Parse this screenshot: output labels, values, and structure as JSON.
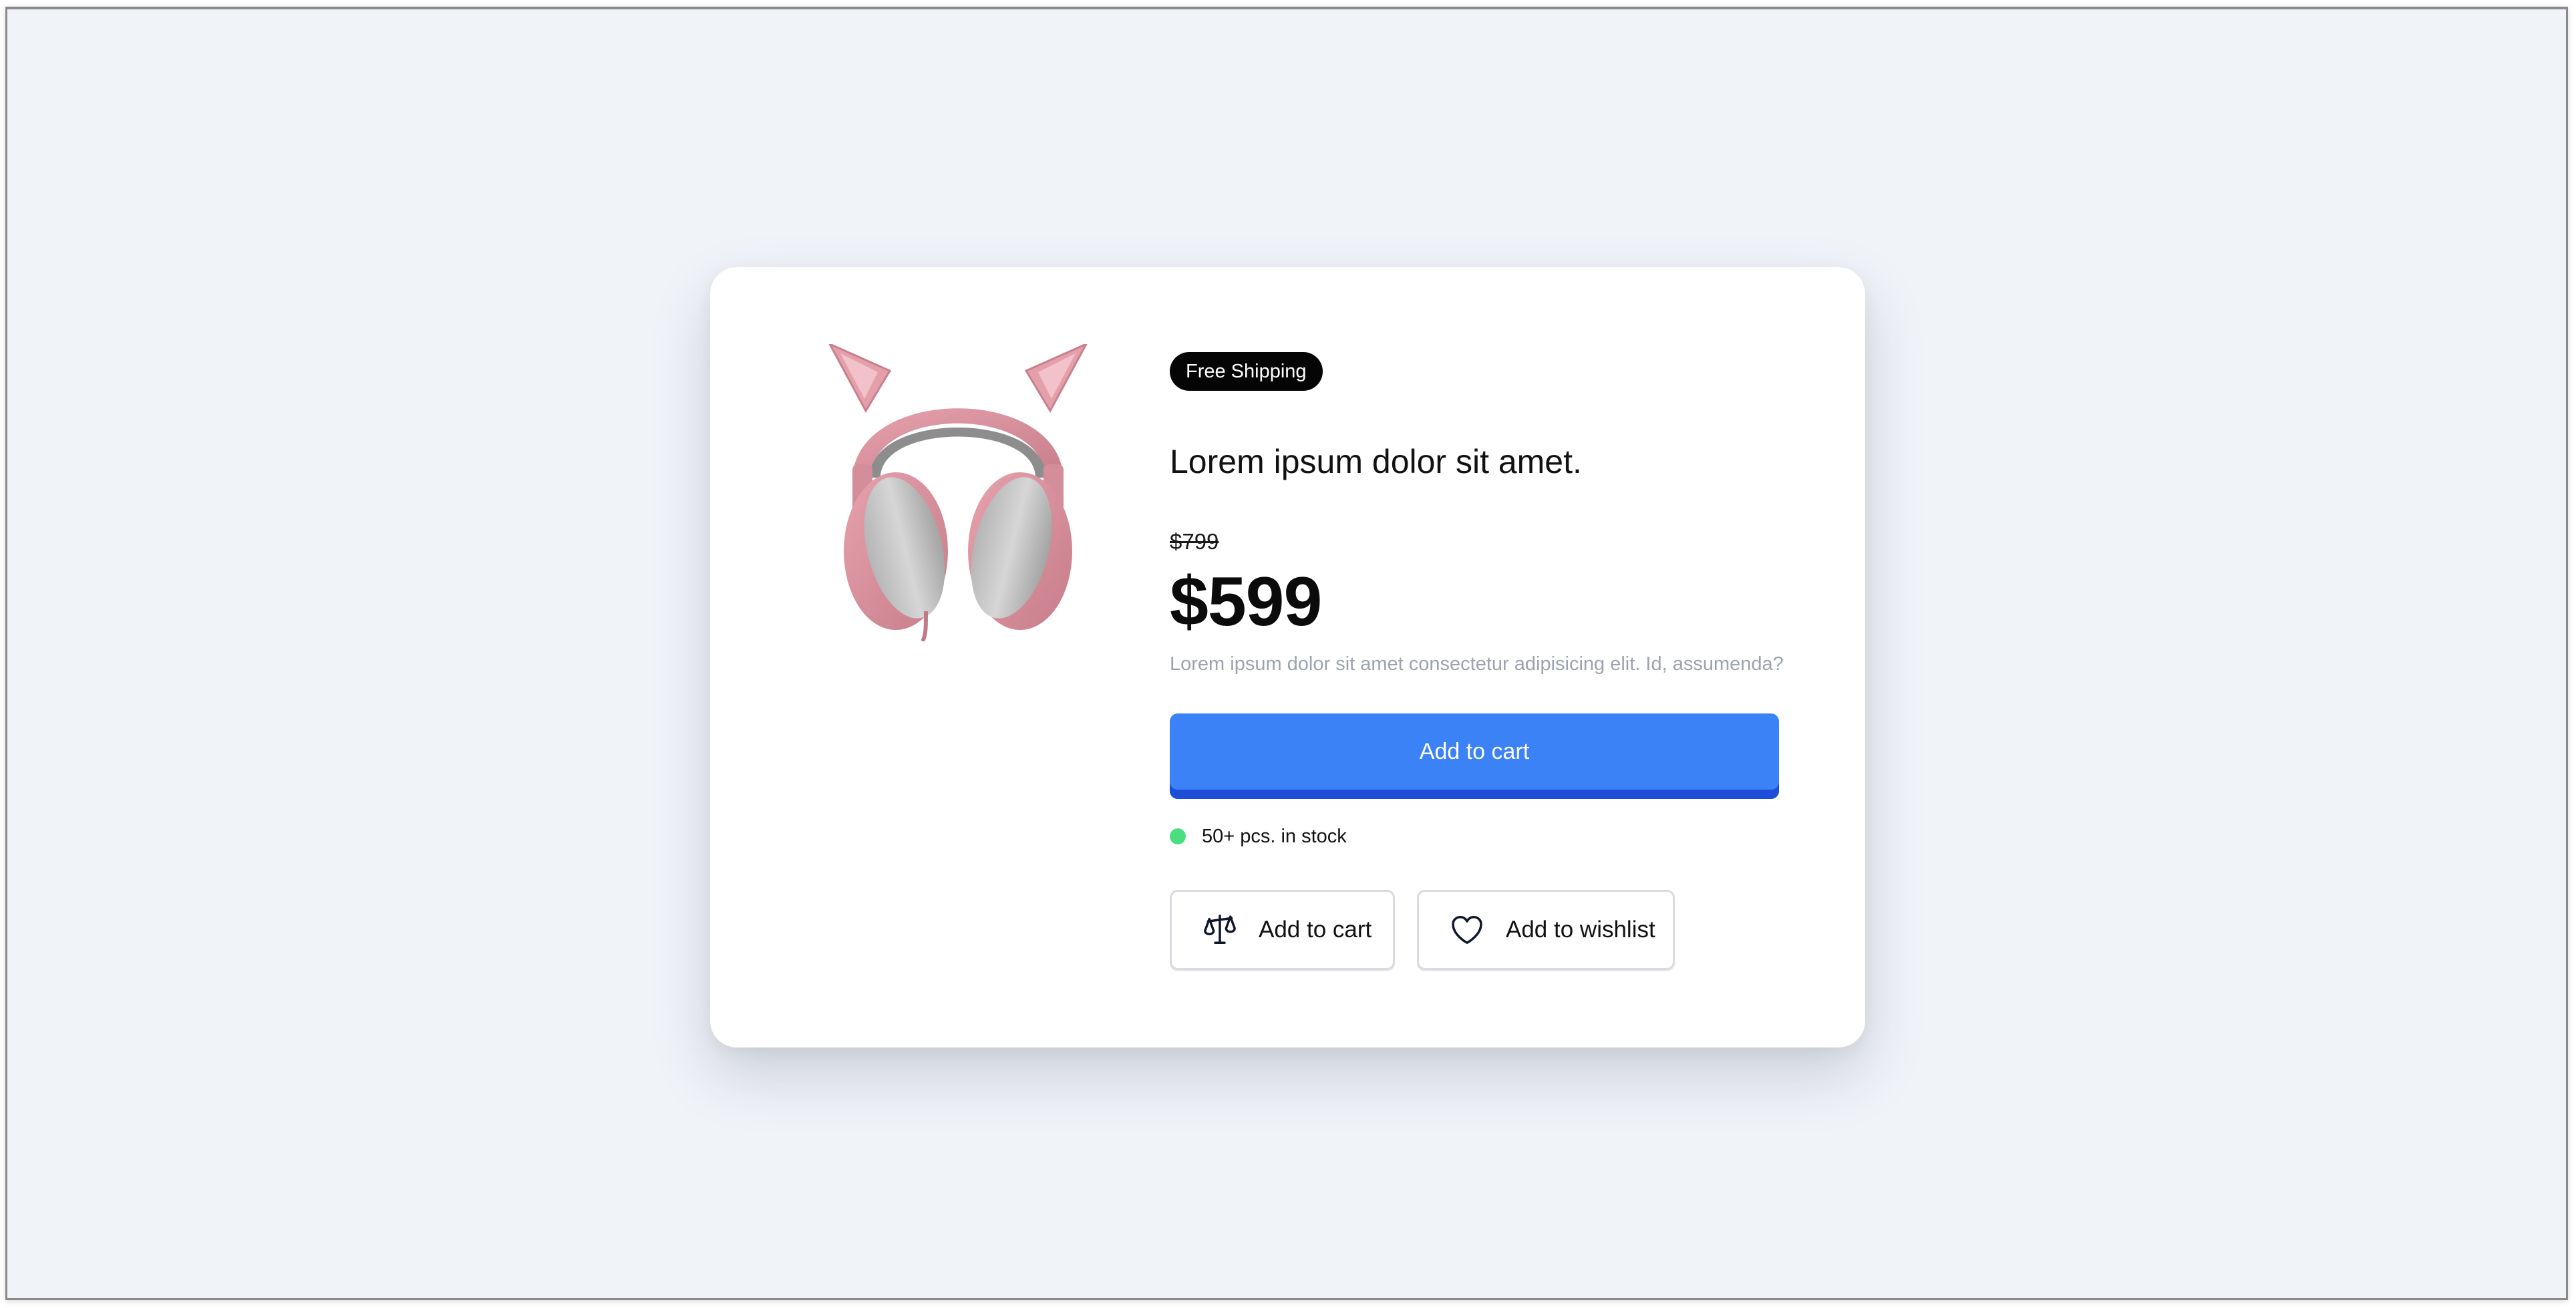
{
  "product": {
    "image_alt": "Pink cat-ear headphones",
    "badge": "Free Shipping",
    "title": "Lorem ipsum dolor sit amet.",
    "old_price": "$799",
    "price": "$599",
    "description": "Lorem ipsum dolor sit amet consectetur adipisicing elit. Id, assumenda?"
  },
  "actions": {
    "add_to_cart_label": "Add to cart",
    "compare_label": "Add to cart",
    "wishlist_label": "Add to wishlist"
  },
  "stock": {
    "text": "50+ pcs. in stock",
    "status_color": "#4ade80"
  },
  "icons": {
    "compare": "scale-icon",
    "wishlist": "heart-icon"
  },
  "colors": {
    "accent": "#3b82f6",
    "accent_dark": "#1d4ed8",
    "page_bg": "#f0f3f8"
  }
}
